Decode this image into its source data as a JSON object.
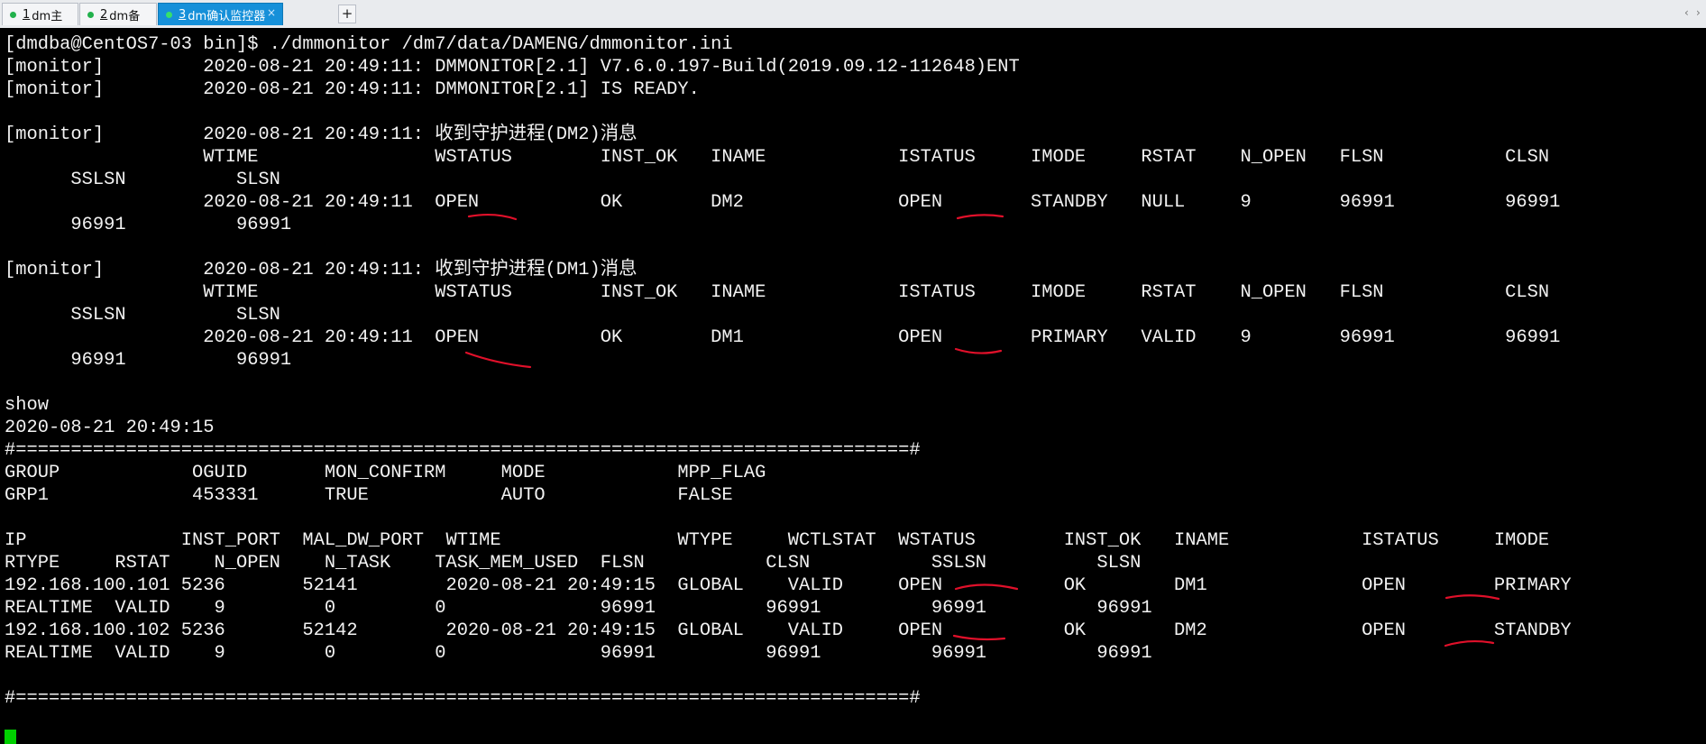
{
  "tabs": [
    {
      "number": "1",
      "label": "dm主"
    },
    {
      "number": "2",
      "label": "dm备"
    },
    {
      "number": "3",
      "label": "dm确认监控器",
      "close": "×"
    }
  ],
  "new_tab_label": "+",
  "nav": {
    "prev": "‹",
    "next": "›"
  },
  "terminal": {
    "lines": [
      "[dmdba@CentOS7-03 bin]$ ./dmmonitor /dm7/data/DAMENG/dmmonitor.ini",
      "[monitor]         2020-08-21 20:49:11: DMMONITOR[2.1] V7.6.0.197-Build(2019.09.12-112648)ENT",
      "[monitor]         2020-08-21 20:49:11: DMMONITOR[2.1] IS READY.",
      "",
      "[monitor]         2020-08-21 20:49:11: 收到守护进程(DM2)消息",
      "                  WTIME                WSTATUS        INST_OK   INAME            ISTATUS     IMODE     RSTAT    N_OPEN   FLSN           CLSN",
      "      SSLSN          SLSN",
      "                  2020-08-21 20:49:11  OPEN           OK        DM2              OPEN        STANDBY   NULL     9        96991          96991",
      "      96991          96991",
      "",
      "[monitor]         2020-08-21 20:49:11: 收到守护进程(DM1)消息",
      "                  WTIME                WSTATUS        INST_OK   INAME            ISTATUS     IMODE     RSTAT    N_OPEN   FLSN           CLSN",
      "      SSLSN          SLSN",
      "                  2020-08-21 20:49:11  OPEN           OK        DM1              OPEN        PRIMARY   VALID    9        96991          96991",
      "      96991          96991",
      "",
      "show",
      "2020-08-21 20:49:15",
      "#=================================================================================#",
      "GROUP            OGUID       MON_CONFIRM     MODE            MPP_FLAG",
      "GRP1             453331      TRUE            AUTO            FALSE",
      "",
      "IP              INST_PORT  MAL_DW_PORT  WTIME                WTYPE     WCTLSTAT  WSTATUS        INST_OK   INAME            ISTATUS     IMODE",
      "RTYPE     RSTAT    N_OPEN    N_TASK    TASK_MEM_USED  FLSN           CLSN           SSLSN          SLSN",
      "192.168.100.101 5236       52141        2020-08-21 20:49:15  GLOBAL    VALID     OPEN           OK        DM1              OPEN        PRIMARY",
      "REALTIME  VALID    9         0         0              96991          96991          96991          96991",
      "192.168.100.102 5236       52142        2020-08-21 20:49:15  GLOBAL    VALID     OPEN           OK        DM2              OPEN        STANDBY",
      "REALTIME  VALID    9         0         0              96991          96991          96991          96991",
      "",
      "#=================================================================================#"
    ],
    "annotation_color": "#e0102a",
    "cursor_color": "#00d000"
  }
}
